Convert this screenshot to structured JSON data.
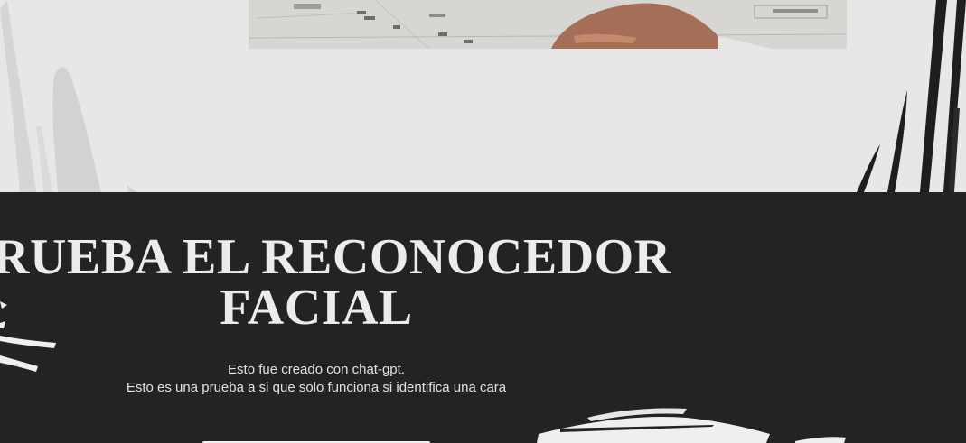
{
  "hero": {
    "title_line1": "PRUEBA EL RECONOCEDOR",
    "title_line2": "FACIAL",
    "description_line1": "Esto fue creado con chat-gpt.",
    "description_line2": "Esto es una prueba a si que solo funciona si identifica una cara"
  },
  "colors": {
    "light_background": "#e8e6e7",
    "dark_background": "#232323",
    "title_text": "#ececec",
    "body_text": "#e2e2e2"
  }
}
